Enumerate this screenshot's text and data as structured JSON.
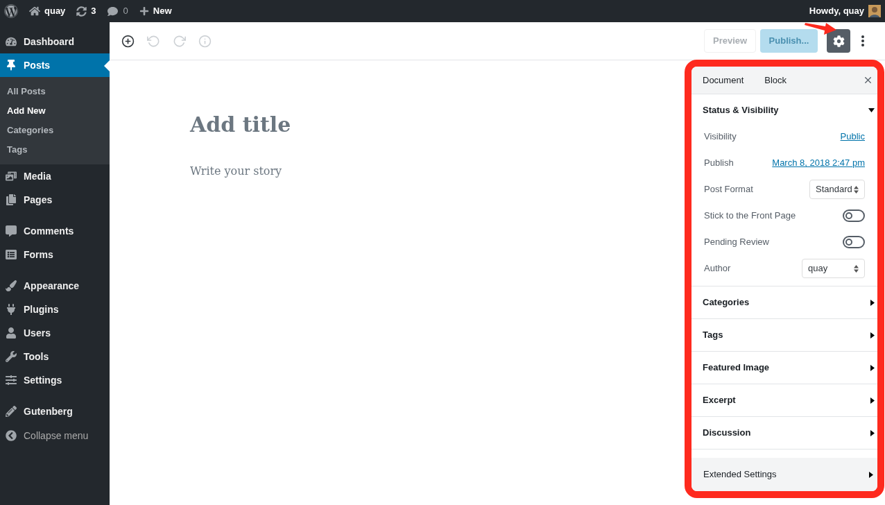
{
  "admin_bar": {
    "site": "quay",
    "updates": "3",
    "comments": "0",
    "new": "New",
    "greeting": "Howdy, quay"
  },
  "sidebar": {
    "items": [
      {
        "label": "Dashboard",
        "selected": false
      },
      {
        "label": "Posts",
        "selected": true,
        "children": [
          {
            "label": "All Posts",
            "selected": false
          },
          {
            "label": "Add New",
            "selected": true
          },
          {
            "label": "Categories",
            "selected": false
          },
          {
            "label": "Tags",
            "selected": false
          }
        ]
      },
      {
        "label": "Media",
        "selected": false
      },
      {
        "label": "Pages",
        "selected": false
      },
      {
        "label": "Comments",
        "selected": false
      },
      {
        "label": "Forms",
        "selected": false
      },
      {
        "label": "Appearance",
        "selected": false
      },
      {
        "label": "Plugins",
        "selected": false
      },
      {
        "label": "Users",
        "selected": false
      },
      {
        "label": "Tools",
        "selected": false
      },
      {
        "label": "Settings",
        "selected": false
      },
      {
        "label": "Gutenberg",
        "selected": false
      }
    ],
    "collapse": "Collapse menu"
  },
  "toolbar": {
    "tools": [
      {
        "disabled": false
      },
      {
        "disabled": true
      },
      {
        "disabled": true
      },
      {
        "disabled": true
      }
    ],
    "preview": "Preview",
    "publish": "Publish...",
    "settings_selected": true
  },
  "editor": {
    "title_placeholder": "Add title",
    "body_placeholder": "Write your story"
  },
  "panel": {
    "tabs": [
      "Document",
      "Block"
    ],
    "sections": [
      {
        "title": "Status & Visibility",
        "expanded": true,
        "rows": [
          {
            "kind": "link",
            "label": "Visibility",
            "value": "Public"
          },
          {
            "kind": "link",
            "label": "Publish",
            "value": "March 8, 2018 2:47 pm"
          },
          {
            "kind": "select",
            "label": "Post Format",
            "value": "Standard"
          },
          {
            "kind": "toggle",
            "label": "Stick to the Front Page",
            "checked": false
          },
          {
            "kind": "toggle",
            "label": "Pending Review",
            "checked": false
          },
          {
            "kind": "select",
            "label": "Author",
            "value": "quay"
          }
        ]
      },
      {
        "title": "Categories",
        "expanded": false
      },
      {
        "title": "Tags",
        "expanded": false
      },
      {
        "title": "Featured Image",
        "expanded": false
      },
      {
        "title": "Excerpt",
        "expanded": false
      },
      {
        "title": "Discussion",
        "expanded": false
      }
    ],
    "extended": {
      "title": "Extended Settings",
      "expanded": false
    }
  }
}
